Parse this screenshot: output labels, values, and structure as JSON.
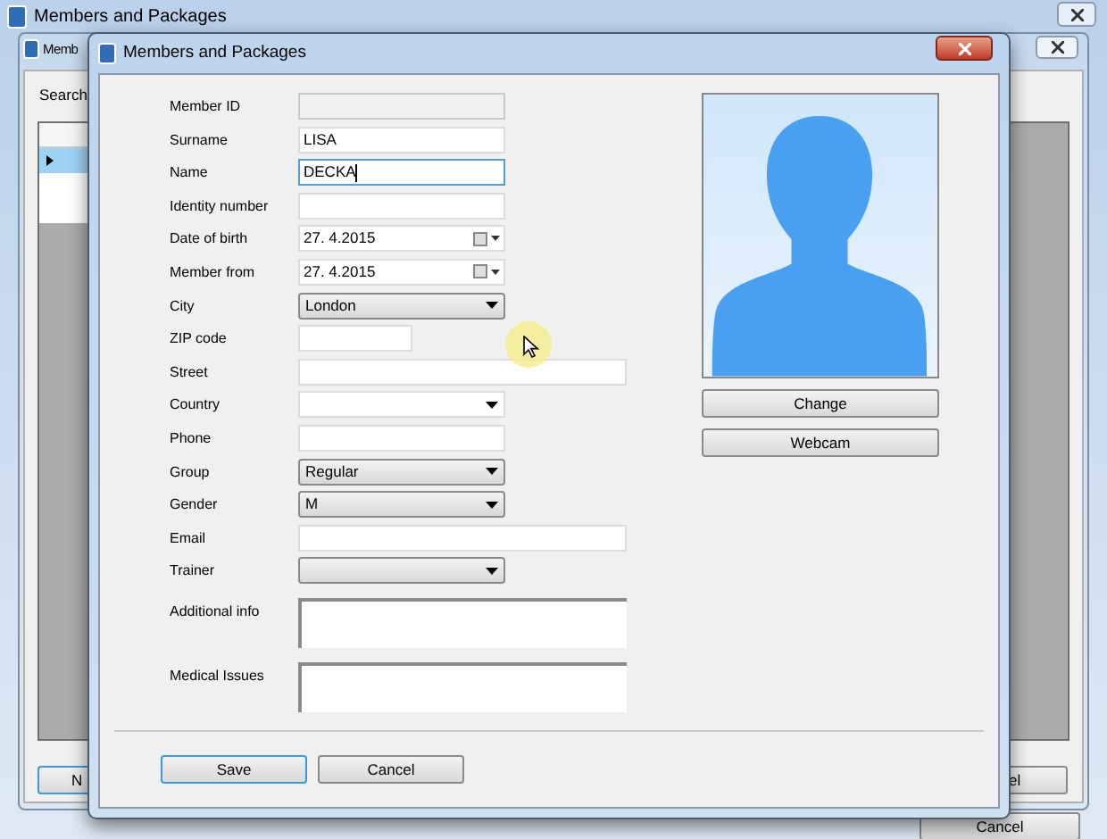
{
  "outer_window": {
    "title": "Members and Packages",
    "bottom_button": "Cancel"
  },
  "list_window": {
    "title": "Memb",
    "search_label": "Search",
    "left_button": "N",
    "right_button": "el"
  },
  "dialog": {
    "title": "Members and Packages",
    "fields": [
      {
        "kind": "text",
        "label": "Member ID",
        "disabled": true,
        "focused": false
      },
      {
        "kind": "text",
        "label": "Surname",
        "value": "LISA",
        "disabled": false,
        "focused": false
      },
      {
        "kind": "text",
        "label": "Name",
        "value": "DECKA",
        "disabled": false,
        "focused": true
      },
      {
        "kind": "text",
        "label": "Identity number",
        "disabled": false,
        "focused": false
      },
      {
        "kind": "date",
        "label": "Date of birth",
        "value": "27.  4.2015"
      },
      {
        "kind": "date",
        "label": "Member from",
        "value": "27.  4.2015"
      },
      {
        "kind": "dropdown",
        "label": "City",
        "value": "London"
      },
      {
        "kind": "short_text",
        "label": "ZIP code"
      },
      {
        "kind": "wide_text",
        "label": "Street"
      },
      {
        "kind": "combo",
        "label": "Country"
      },
      {
        "kind": "text",
        "label": "Phone",
        "disabled": false,
        "focused": false
      },
      {
        "kind": "dropdown",
        "label": "Group",
        "value": "Regular"
      },
      {
        "kind": "dropdown",
        "label": "Gender",
        "value": "M"
      },
      {
        "kind": "wide_text",
        "label": "Email"
      },
      {
        "kind": "dropdown",
        "label": "Trainer"
      },
      {
        "kind": "memo",
        "label": "Additional info"
      },
      {
        "kind": "memo",
        "label": "Medical Issues"
      }
    ],
    "photo_buttons": [
      "Change",
      "Webcam"
    ],
    "buttons": [
      {
        "label": "Save",
        "default": true
      },
      {
        "label": "Cancel",
        "default": false
      }
    ]
  }
}
